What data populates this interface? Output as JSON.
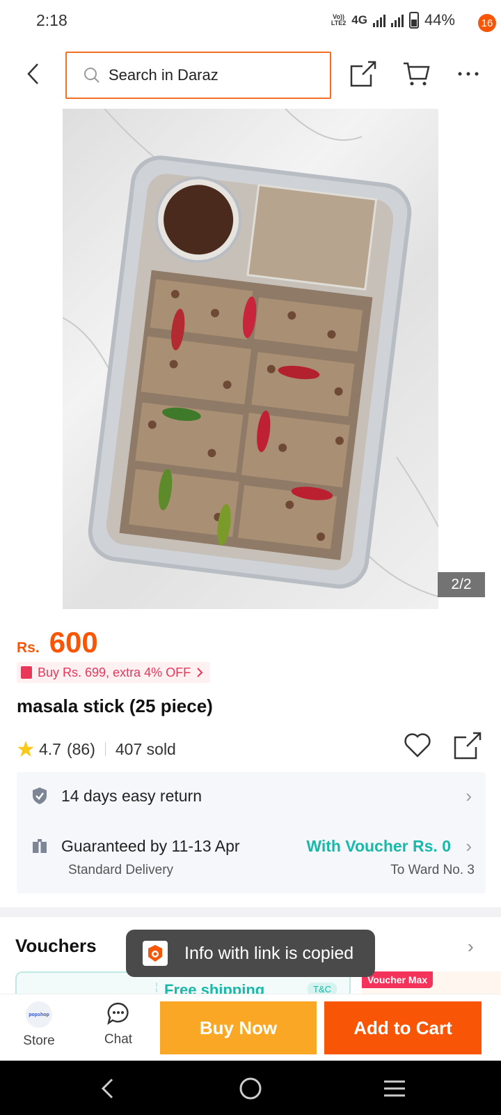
{
  "status_bar": {
    "time": "2:18",
    "volte_line1": "Vo))",
    "volte_line2": "LTE2",
    "network": "4G",
    "battery": "44%"
  },
  "header": {
    "search_placeholder": "Search in Daraz",
    "cart_badge": "16",
    "icons": [
      "back-arrow-icon",
      "search-icon",
      "share-icon",
      "cart-icon",
      "more-icon"
    ]
  },
  "gallery": {
    "counter": "2/2"
  },
  "product": {
    "currency": "Rs.",
    "price": "600",
    "promo": "Buy Rs. 699, extra 4% OFF",
    "title": "masala stick (25 piece)",
    "rating": "4.7",
    "reviews": "(86)",
    "sold": "407 sold"
  },
  "delivery": {
    "return_text": "14 days easy return",
    "guarantee_text": "Guaranteed by 11-13 Apr",
    "voucher_text": "With Voucher Rs. 0",
    "delivery_type": "Standard Delivery",
    "destination": "To Ward No. 3"
  },
  "vouchers": {
    "title": "Vouchers",
    "free_shipping": "Free shipping",
    "tc": "T&C",
    "voucher_max": "Voucher Max"
  },
  "toast": {
    "message": "Info with link is copied"
  },
  "bottom_bar": {
    "store_logo_text": "popshop",
    "store_label": "Store",
    "chat_label": "Chat",
    "buy_now": "Buy Now",
    "add_to_cart": "Add to Cart"
  },
  "colors": {
    "brand_orange": "#f85606",
    "buy_now_yellow": "#fba726",
    "voucher_teal": "#1ab8a8",
    "promo_pink": "#e8385a"
  }
}
